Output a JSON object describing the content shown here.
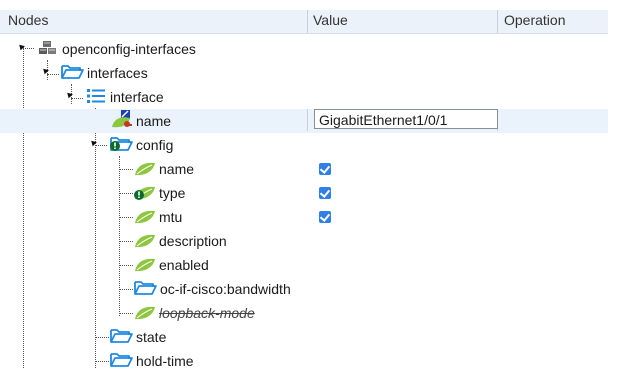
{
  "columns": {
    "nodes": "Nodes",
    "value": "Value",
    "operation": "Operation"
  },
  "tree": {
    "root": "openconfig-interfaces",
    "interfaces": "interfaces",
    "interface": "interface",
    "name": "name",
    "config": "config",
    "config_name": "name",
    "config_type": "type",
    "config_mtu": "mtu",
    "config_description": "description",
    "config_enabled": "enabled",
    "config_bandwidth": "oc-if-cisco:bandwidth",
    "config_loopback": "loopback-mode",
    "state": "state",
    "hold_time": "hold-time"
  },
  "values": {
    "name_input": "GigabitEthernet1/0/1",
    "config_name_checked": true,
    "config_type_checked": true,
    "config_mtu_checked": true
  },
  "colors": {
    "folder": "#1e8ae0",
    "leaf": "#8dc63f",
    "list": "#1e8ae0",
    "warning": "#0a6b2c"
  }
}
